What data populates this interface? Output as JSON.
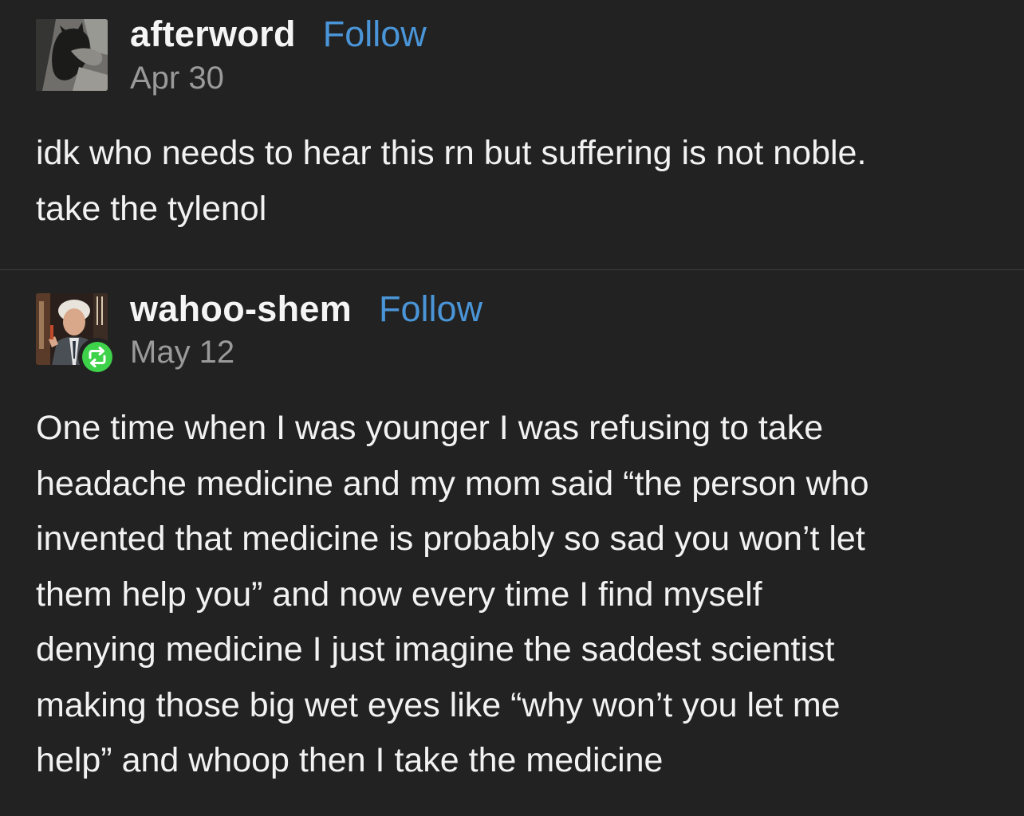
{
  "posts": [
    {
      "username": "afterword",
      "follow_label": "Follow",
      "date": "Apr 30",
      "avatar_icon": "cat-photo-avatar",
      "body_lines": [
        "idk who needs to hear this rn but suffering is not noble.",
        "take the tylenol"
      ]
    },
    {
      "username": "wahoo-shem",
      "follow_label": "Follow",
      "date": "May 12",
      "avatar_icon": "man-photo-avatar",
      "badge_icon": "reblog-icon",
      "body_lines": [
        "One time when I was younger I was refusing to take",
        "headache medicine and my mom said “the person who",
        "invented that medicine is probably so sad you won’t let",
        "them help you” and now every time I find myself",
        "denying medicine I just imagine the saddest scientist",
        "making those big wet eyes like “why won’t you let me",
        "help” and whoop then I take the medicine"
      ]
    }
  ],
  "colors": {
    "background": "#222222",
    "follow": "#4a95d8",
    "date": "#9a9a9a",
    "reblog_badge": "#3ed24a"
  }
}
